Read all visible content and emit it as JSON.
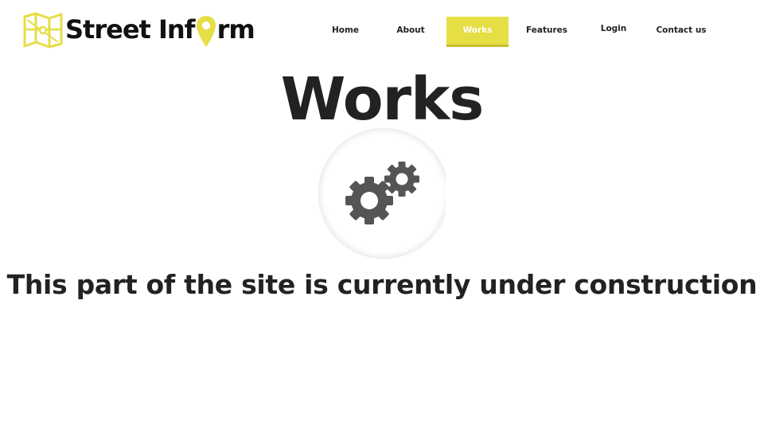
{
  "header": {
    "logo_text_before_pin": "Street Inf",
    "logo_text_after_pin": "rm",
    "logo_icon": "folded-map-icon",
    "logo_pin_icon": "location-pin-icon"
  },
  "nav": {
    "items": [
      {
        "label": "Home",
        "active": false
      },
      {
        "label": "About",
        "active": false
      },
      {
        "label": "Works",
        "active": true
      },
      {
        "label": "Features",
        "active": false
      },
      {
        "label": "Login",
        "active": false
      },
      {
        "label": "Contact us",
        "active": false
      }
    ]
  },
  "main": {
    "title": "Works",
    "illustration_icon": "gears-icon",
    "message": "This part of the site is currently under construction"
  },
  "colors": {
    "accent": "#e5de45",
    "accent_dark": "#c7c02b",
    "text": "#222222",
    "gear": "#555555"
  }
}
